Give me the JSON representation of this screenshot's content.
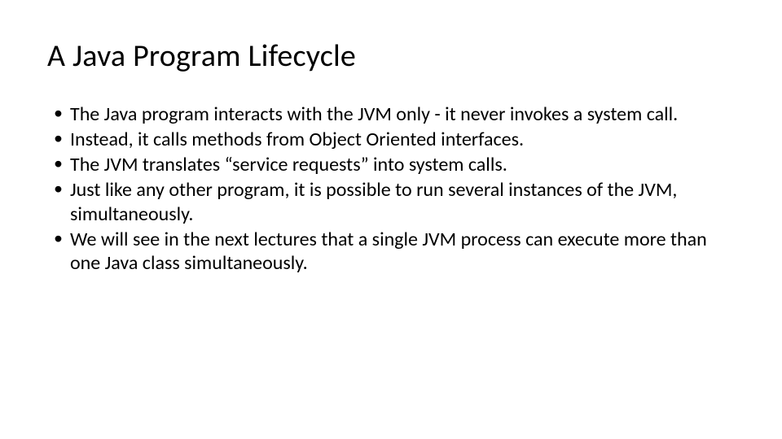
{
  "slide": {
    "title": "A Java Program Lifecycle",
    "bullets": [
      "The Java program interacts with the JVM only - it never invokes a system call.",
      "Instead, it calls methods from Object Oriented interfaces.",
      "The JVM translates “service requests” into system calls.",
      "Just like any other program, it is possible to run several instances of the JVM, simultaneously.",
      "We will see in the next lectures that a single JVM process can execute more than one Java class simultaneously."
    ]
  }
}
